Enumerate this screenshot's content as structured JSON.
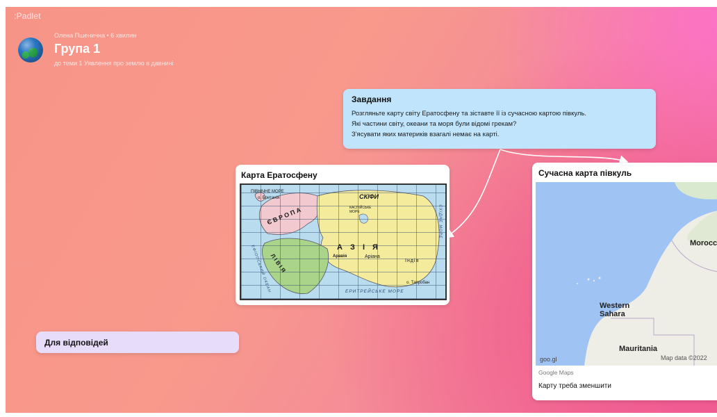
{
  "app": {
    "brand": ":Padlet"
  },
  "header": {
    "meta": "Олена Пшенична • 6 хвилин",
    "title": "Група 1",
    "subtitle": "до теми 1 Уявлення про землю в давнині"
  },
  "task_card": {
    "title": "Завдання",
    "lines": [
      "Розгляньте карту світу Ератосфену та зіставте її із сучасною картою півкуль.",
      "Які частини світу, океани та моря були відомі грекам?",
      "З'ясувати яких материків взагалі немає на карті."
    ],
    "color": "#bfe4fb"
  },
  "erato_card": {
    "title": "Карта Ератосфену",
    "map_labels": {
      "north_sea": "ПІВНІЧНЕ МОРЕ",
      "britain": "о. Британія",
      "europe": "Є В Р О П А",
      "scythia": "СКІФИ",
      "caspian": "КАСПІЙСЬКЕ МОРЕ",
      "asia": "А З І Я",
      "arabia": "Аравія",
      "ariana": "Аріана",
      "india": "Індія",
      "libya": "Л І В І Я",
      "ethiopian_ocean": "ЕФІОПСЬКИЙ ОКЕАН",
      "eritrean_sea": "ЕРИТРЕЙСЬКЕ МОРЕ",
      "taprobane": "о. Тапробан",
      "east_sea": "СХІДНЕ МОРЕ"
    }
  },
  "modern_card": {
    "title": "Сучасна карта півкуль",
    "map_labels": {
      "morocco": "Morocco",
      "western_sahara": "Western\nSahara",
      "mauritania": "Mauritania"
    },
    "map_link": "goo.gl",
    "map_attribution": "Map data ©2022",
    "source": "Google Maps",
    "caption": "Карту треба зменшити"
  },
  "answers_card": {
    "title": "Для відповідей",
    "color": "#e8dcfb"
  },
  "colors": {
    "background_start": "#f79488",
    "background_end": "#f06a9a",
    "connector": "#ffffff"
  }
}
